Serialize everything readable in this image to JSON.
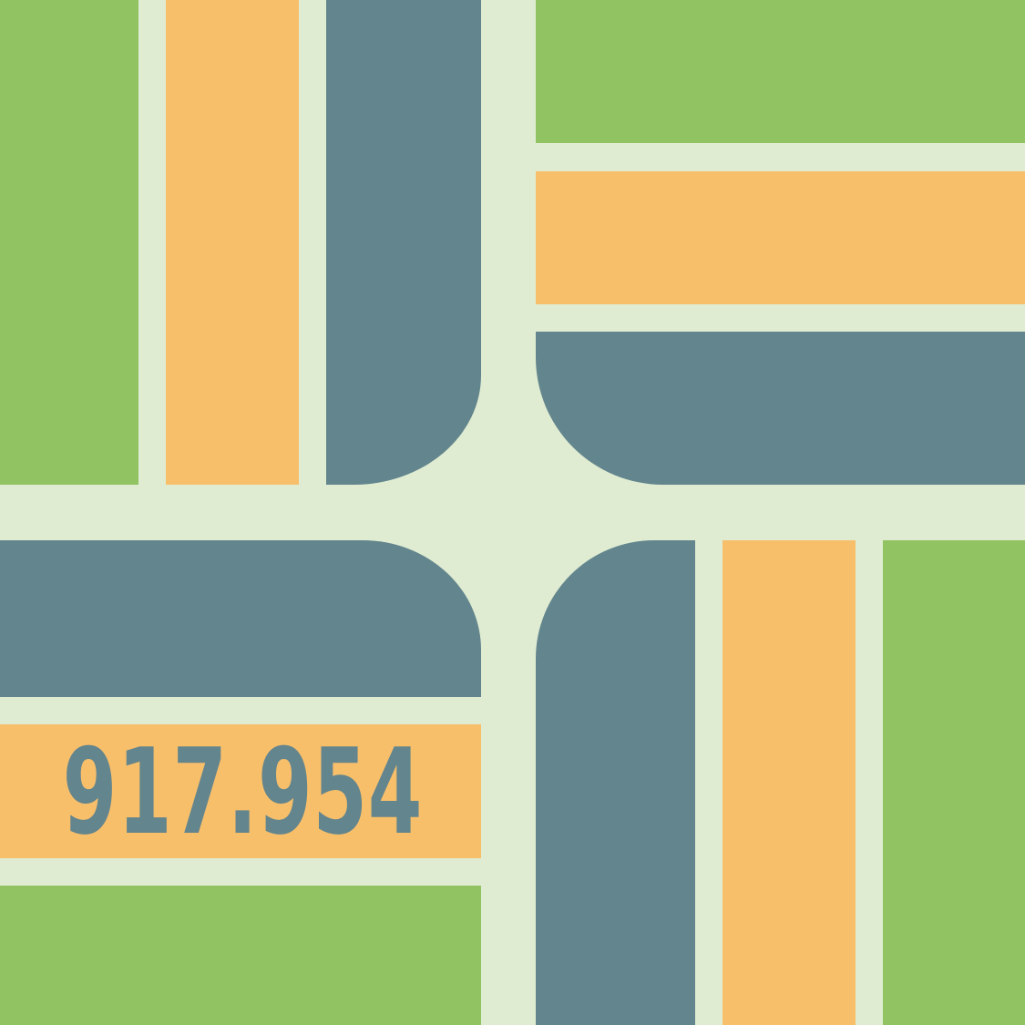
{
  "colors": {
    "background": "#dfecd2",
    "green": "#92c362",
    "orange": "#f8bf6b",
    "slate": "#63858d"
  },
  "label": {
    "value": "917.954"
  }
}
